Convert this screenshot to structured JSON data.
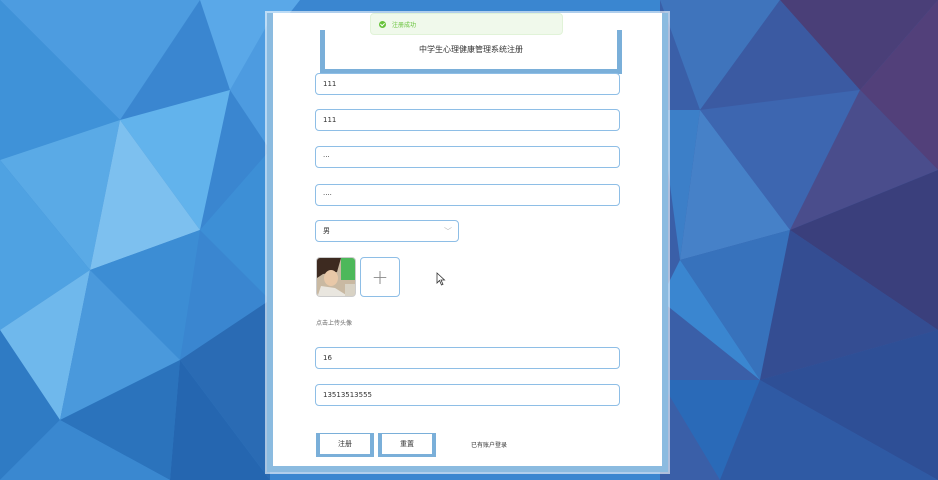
{
  "toast": {
    "message": "注册成功",
    "icon": "success-check-icon",
    "color": "#67c23a"
  },
  "form": {
    "title": "中学生心理健康管理系统注册",
    "username_value": "111",
    "name_value": "111",
    "password_value": "···",
    "confirm_password_value": "····",
    "gender_value": "男",
    "upload_hint": "点击上传头像",
    "age_value": "16",
    "phone_value": "13513513555"
  },
  "buttons": {
    "register_label": "注册",
    "reset_label": "重置",
    "login_link": "已有账户登录"
  },
  "colors": {
    "accent_border": "#8ebee6",
    "frame": "#7aafd9",
    "background": "#2d6fc0"
  }
}
